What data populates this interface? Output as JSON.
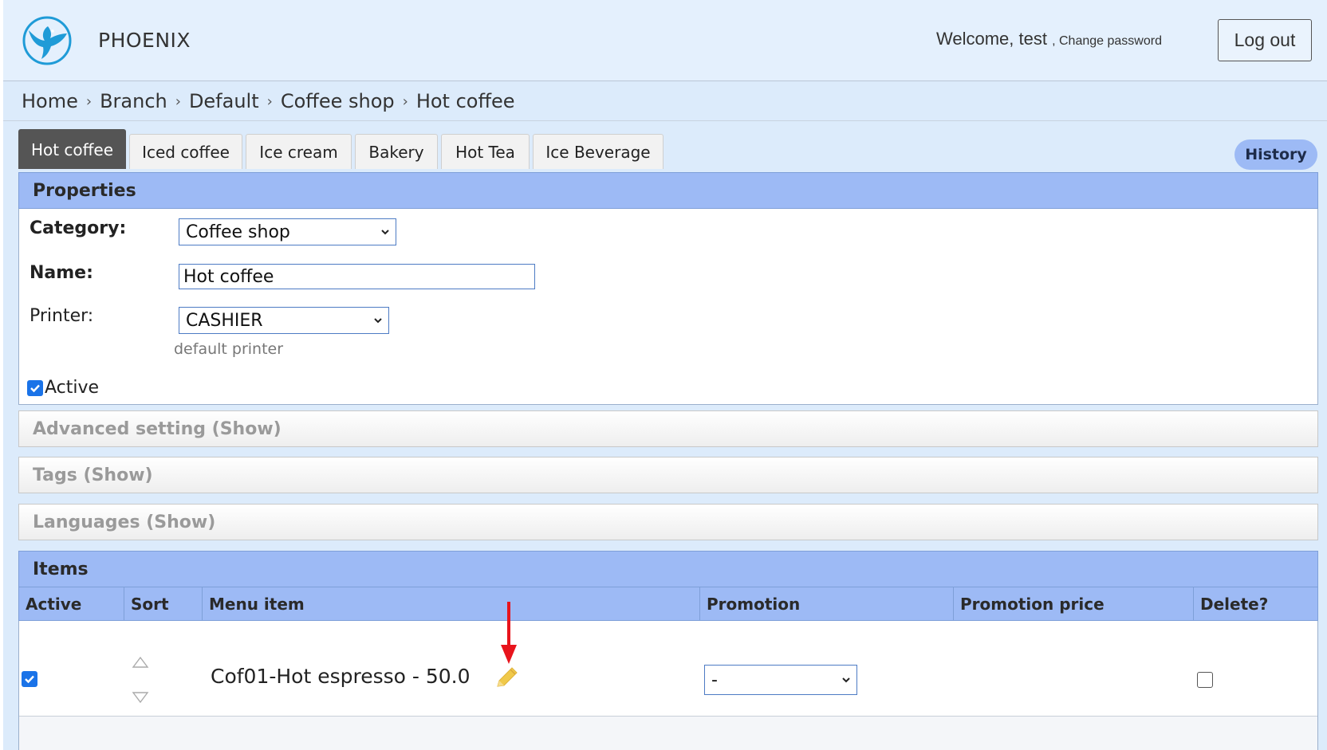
{
  "header": {
    "brand": "PHOENIX",
    "welcome": "Welcome, test",
    "change_password": ", Change password",
    "logout": "Log out"
  },
  "breadcrumb": [
    "Home",
    "Branch",
    "Default",
    "Coffee shop",
    "Hot coffee"
  ],
  "tabs": [
    "Hot coffee",
    "Iced coffee",
    "Ice cream",
    "Bakery",
    "Hot Tea",
    "Ice Beverage"
  ],
  "active_tab": "Hot coffee",
  "history_button": "History",
  "properties": {
    "title": "Properties",
    "category_label": "Category:",
    "category_value": "Coffee shop",
    "name_label": "Name:",
    "name_value": "Hot coffee",
    "printer_label": "Printer:",
    "printer_value": "CASHIER",
    "printer_hint": "default printer",
    "active_label": "Active",
    "active_checked": true
  },
  "sections": [
    "Advanced setting (Show)",
    "Tags (Show)",
    "Languages (Show)"
  ],
  "items": {
    "title": "Items",
    "columns": [
      "Active",
      "Sort",
      "Menu item",
      "Promotion",
      "Promotion price",
      "Delete?"
    ],
    "rows": [
      {
        "active": true,
        "menu_item": "Cof01-Hot espresso - 50.0",
        "promotion": "-",
        "delete": false
      }
    ]
  },
  "colors": {
    "accent": "#9dbaf5",
    "checkbox": "#1a73e8",
    "annotation_arrow": "#e8141c",
    "pencil": "#f0c94a"
  }
}
